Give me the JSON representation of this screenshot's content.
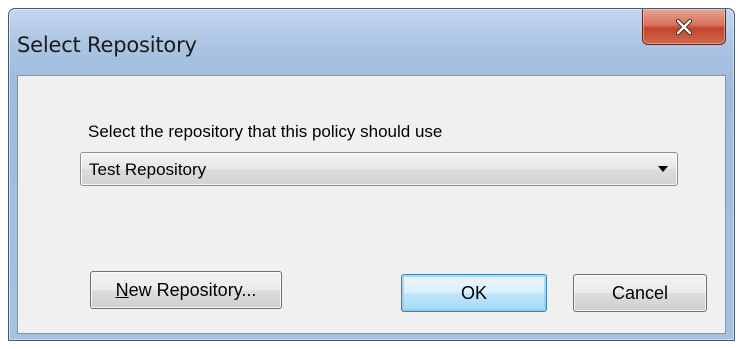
{
  "window": {
    "title": "Select Repository",
    "close_glyph": "x"
  },
  "dialog": {
    "prompt": "Select the repository that this policy should use",
    "repository_select": {
      "selected": "Test Repository"
    }
  },
  "buttons": {
    "new_repository": {
      "mnemonic": "N",
      "rest": "ew Repository..."
    },
    "ok": "OK",
    "cancel": "Cancel"
  },
  "icons": {
    "close": "close-icon",
    "dropdown": "chevron-down-icon"
  },
  "colors": {
    "titlebar": "#a9c3e2",
    "client_bg": "#f0f0f0",
    "close_button": "#c4452d",
    "default_button_border": "#3c7fb1"
  }
}
